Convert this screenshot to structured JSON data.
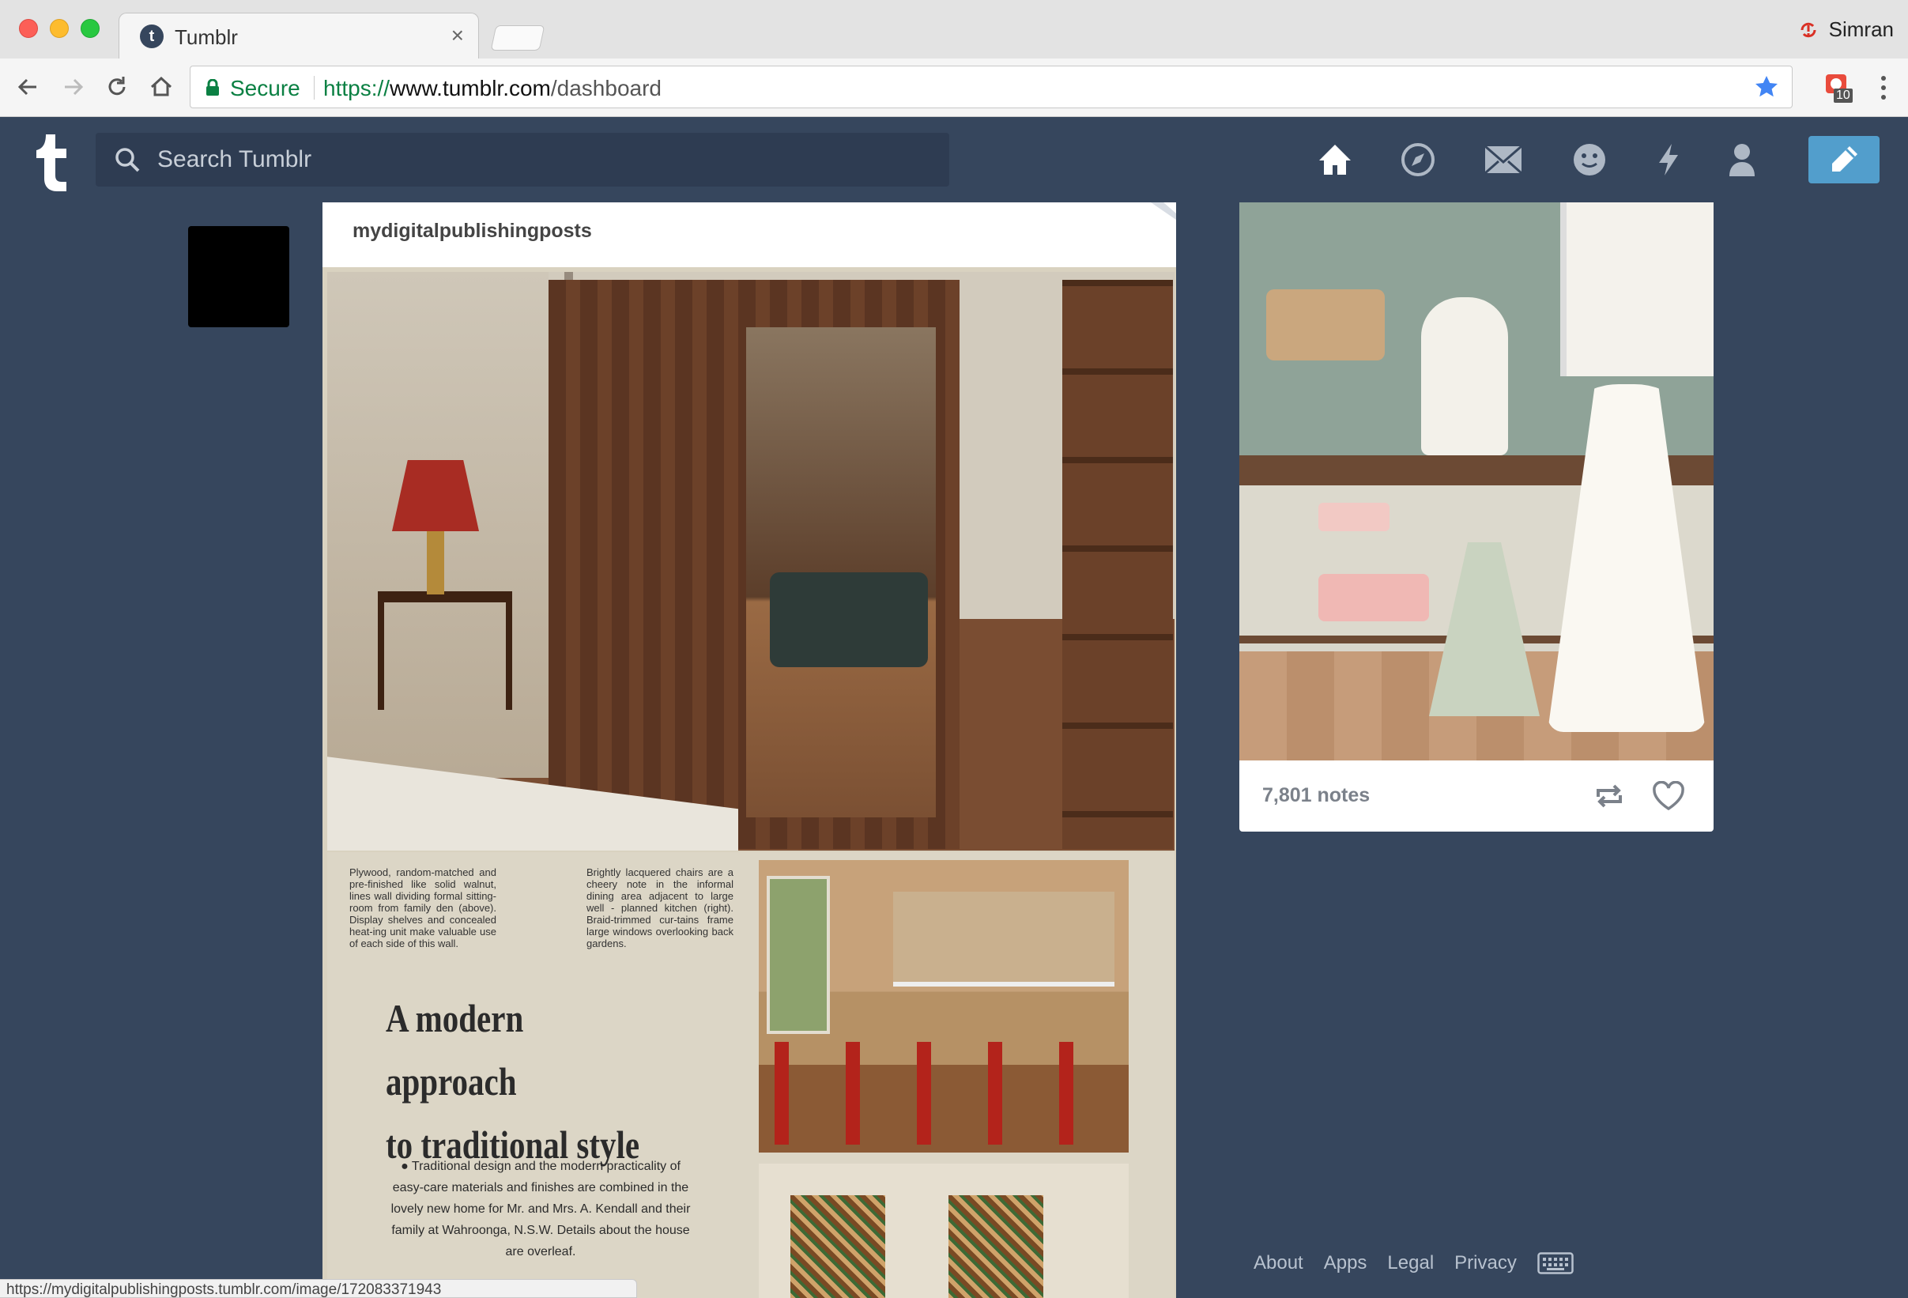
{
  "browser": {
    "tab_title": "Tumblr",
    "tab_close": "×",
    "profile_name": "Simran",
    "secure_label": "Secure",
    "url_scheme": "https://",
    "url_host": "www.tumblr.com",
    "url_path": "/dashboard",
    "extension_badge": "10",
    "status_url": "https://mydigitalpublishingposts.tumblr.com/image/172083371943"
  },
  "tumblr": {
    "logo_letter": "t",
    "search_placeholder": "Search Tumblr",
    "nav_icons": [
      "home-icon",
      "explore-icon",
      "inbox-icon",
      "messaging-icon",
      "activity-icon",
      "account-icon"
    ],
    "compose_icon": "pencil-icon",
    "accent": "#529ecc",
    "background": "#36465d"
  },
  "post": {
    "blog_name": "mydigitalpublishingposts",
    "caption_left": "Plywood, random-matched and pre-finished like solid walnut, lines wall dividing formal sitting-room from family den (above). Display shelves and concealed heat-ing unit make valuable use of each side of this wall.",
    "caption_right": "Brightly lacquered chairs are a cheery note in the informal dining area adjacent to large well - planned kitchen (right). Braid-trimmed cur-tains frame large windows overlooking back gardens.",
    "headline_line1": "A modern approach",
    "headline_line2": "to traditional style",
    "blurb": "● Traditional design and the modern practicality of easy-care materials and finishes are combined in the lovely new home for Mr. and Mrs. A. Kendall and their family at Wahroonga, N.S.W. Details about the house are overleaf."
  },
  "post2": {
    "notes": "7,801 notes"
  },
  "footer": {
    "links": [
      "About",
      "Apps",
      "Legal",
      "Privacy"
    ]
  }
}
